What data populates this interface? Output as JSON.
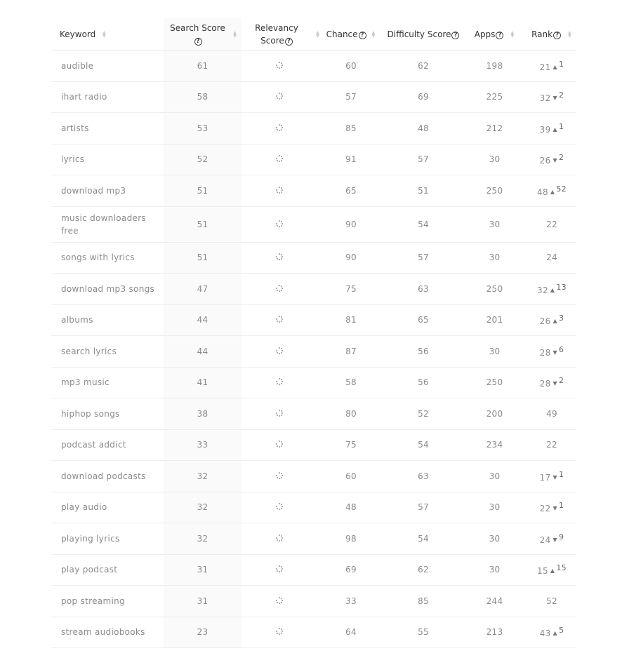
{
  "columns": {
    "keyword": "Keyword",
    "search_score": "Search Score",
    "relevancy_score_line1": "Relevancy",
    "relevancy_score_line2": "Score",
    "chance": "Chance",
    "difficulty_score": "Difficulty Score",
    "apps": "Apps",
    "rank": "Rank"
  },
  "icons": {
    "help": "?",
    "sort_up": "▲",
    "sort_down": "▼",
    "rank_up": "▲",
    "rank_down": "▼",
    "relevancy_loading": "loading-spinner-icon"
  },
  "rows": [
    {
      "keyword": "audible",
      "search_score": "61",
      "chance": "60",
      "difficulty": "62",
      "apps": "198",
      "rank": "21",
      "rank_change": "1",
      "rank_direction": "up"
    },
    {
      "keyword": "ihart radio",
      "search_score": "58",
      "chance": "57",
      "difficulty": "69",
      "apps": "225",
      "rank": "32",
      "rank_change": "2",
      "rank_direction": "down"
    },
    {
      "keyword": "artists",
      "search_score": "53",
      "chance": "85",
      "difficulty": "48",
      "apps": "212",
      "rank": "39",
      "rank_change": "1",
      "rank_direction": "up"
    },
    {
      "keyword": "lyrics",
      "search_score": "52",
      "chance": "91",
      "difficulty": "57",
      "apps": "30",
      "rank": "26",
      "rank_change": "2",
      "rank_direction": "down"
    },
    {
      "keyword": "download mp3",
      "search_score": "51",
      "chance": "65",
      "difficulty": "51",
      "apps": "250",
      "rank": "48",
      "rank_change": "52",
      "rank_direction": "up"
    },
    {
      "keyword": "music downloaders free",
      "search_score": "51",
      "chance": "90",
      "difficulty": "54",
      "apps": "30",
      "rank": "22",
      "rank_change": "",
      "rank_direction": ""
    },
    {
      "keyword": "songs with lyrics",
      "search_score": "51",
      "chance": "90",
      "difficulty": "57",
      "apps": "30",
      "rank": "24",
      "rank_change": "",
      "rank_direction": ""
    },
    {
      "keyword": "download mp3 songs",
      "search_score": "47",
      "chance": "75",
      "difficulty": "63",
      "apps": "250",
      "rank": "32",
      "rank_change": "13",
      "rank_direction": "up"
    },
    {
      "keyword": "albums",
      "search_score": "44",
      "chance": "81",
      "difficulty": "65",
      "apps": "201",
      "rank": "26",
      "rank_change": "3",
      "rank_direction": "up"
    },
    {
      "keyword": "search lyrics",
      "search_score": "44",
      "chance": "87",
      "difficulty": "56",
      "apps": "30",
      "rank": "28",
      "rank_change": "6",
      "rank_direction": "down"
    },
    {
      "keyword": "mp3 music",
      "search_score": "41",
      "chance": "58",
      "difficulty": "56",
      "apps": "250",
      "rank": "28",
      "rank_change": "2",
      "rank_direction": "down"
    },
    {
      "keyword": "hiphop songs",
      "search_score": "38",
      "chance": "80",
      "difficulty": "52",
      "apps": "200",
      "rank": "49",
      "rank_change": "",
      "rank_direction": ""
    },
    {
      "keyword": "podcast addict",
      "search_score": "33",
      "chance": "75",
      "difficulty": "54",
      "apps": "234",
      "rank": "22",
      "rank_change": "",
      "rank_direction": ""
    },
    {
      "keyword": "download podcasts",
      "search_score": "32",
      "chance": "60",
      "difficulty": "63",
      "apps": "30",
      "rank": "17",
      "rank_change": "1",
      "rank_direction": "down"
    },
    {
      "keyword": "play audio",
      "search_score": "32",
      "chance": "48",
      "difficulty": "57",
      "apps": "30",
      "rank": "22",
      "rank_change": "1",
      "rank_direction": "down"
    },
    {
      "keyword": "playing lyrics",
      "search_score": "32",
      "chance": "98",
      "difficulty": "54",
      "apps": "30",
      "rank": "24",
      "rank_change": "9",
      "rank_direction": "down"
    },
    {
      "keyword": "play podcast",
      "search_score": "31",
      "chance": "69",
      "difficulty": "62",
      "apps": "30",
      "rank": "15",
      "rank_change": "15",
      "rank_direction": "up"
    },
    {
      "keyword": "pop streaming",
      "search_score": "31",
      "chance": "33",
      "difficulty": "85",
      "apps": "244",
      "rank": "52",
      "rank_change": "",
      "rank_direction": ""
    },
    {
      "keyword": "stream audiobooks",
      "search_score": "23",
      "chance": "64",
      "difficulty": "55",
      "apps": "213",
      "rank": "43",
      "rank_change": "5",
      "rank_direction": "up"
    }
  ]
}
